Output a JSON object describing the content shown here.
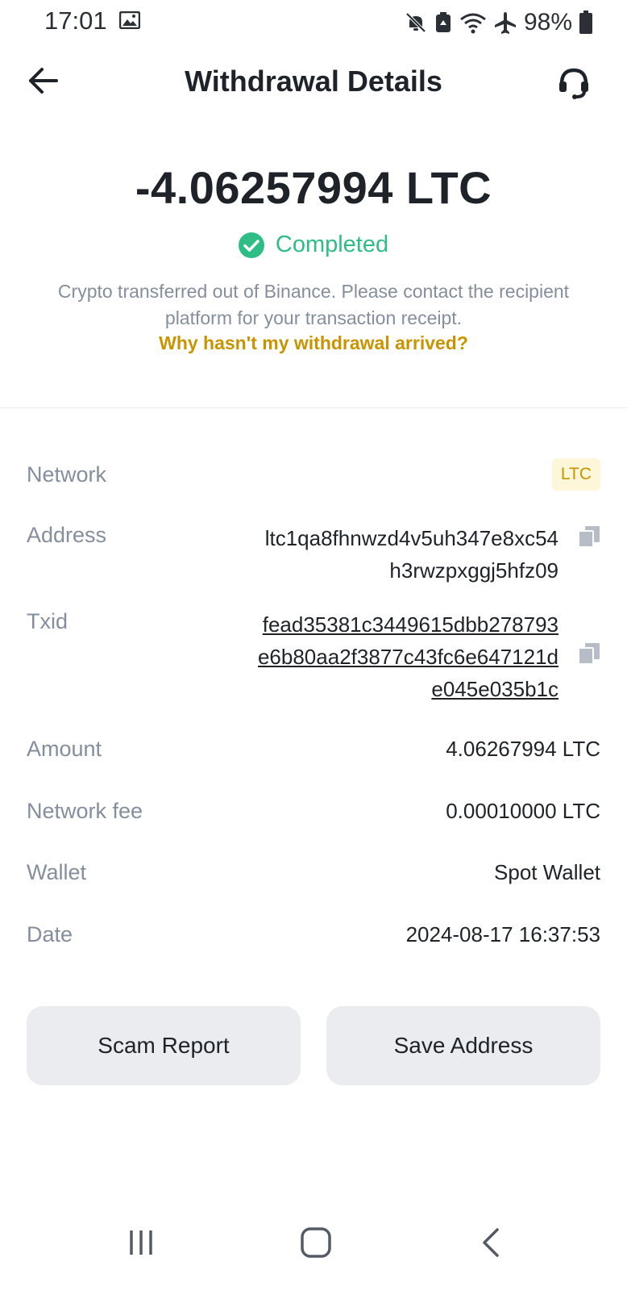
{
  "status_bar": {
    "time": "17:01",
    "battery": "98%"
  },
  "header": {
    "title": "Withdrawal Details"
  },
  "summary": {
    "amount": "-4.06257994 LTC",
    "status": "Completed",
    "description": "Crypto transferred out of Binance. Please contact the recipient platform for your transaction receipt.",
    "help_link": "Why hasn't my withdrawal arrived?"
  },
  "details": {
    "network_label": "Network",
    "network_value": "LTC",
    "address_label": "Address",
    "address_line1": "ltc1qa8fhnwzd4v5uh347e8xc54",
    "address_line2": "h3rwzpxggj5hfz09",
    "txid_label": "Txid",
    "txid_line1": "fead35381c3449615dbb278793",
    "txid_line2": "e6b80aa2f3877c43fc6e647121d",
    "txid_line3": "e045e035b1c",
    "amount_label": "Amount",
    "amount_value": "4.06267994 LTC",
    "fee_label": "Network fee",
    "fee_value": "0.00010000 LTC",
    "wallet_label": "Wallet",
    "wallet_value": "Spot Wallet",
    "date_label": "Date",
    "date_value": "2024-08-17 16:37:53"
  },
  "actions": {
    "scam_report": "Scam Report",
    "save_address": "Save Address"
  },
  "colors": {
    "success": "#2ebd85",
    "link": "#c99400",
    "muted": "#848e9c",
    "primary_text": "#1e2329",
    "button_bg": "#eaecef",
    "badge_bg": "#fef6d8"
  },
  "icons": {
    "status_bar": [
      "gallery-icon",
      "mute-icon",
      "recycle-icon",
      "wifi-icon",
      "airplane-icon",
      "battery-icon"
    ],
    "header": [
      "back-arrow-icon",
      "headset-icon"
    ],
    "rows": [
      "copy-icon"
    ],
    "nav": [
      "recents-icon",
      "home-icon",
      "back-icon"
    ]
  }
}
